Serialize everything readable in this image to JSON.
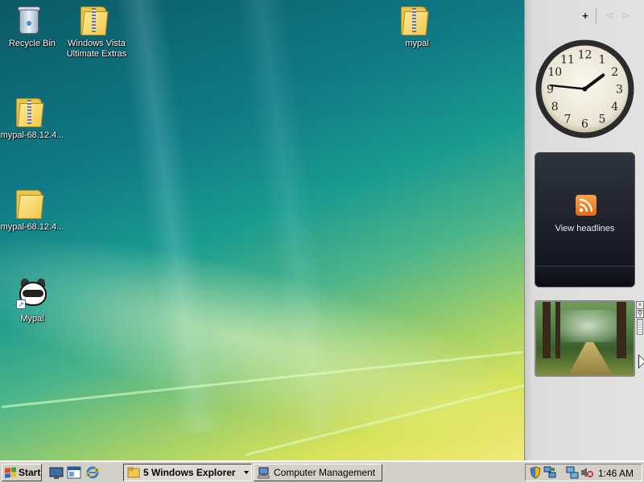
{
  "desktop": {
    "icons": [
      {
        "label": "Recycle Bin",
        "icon": "recycle-bin-icon"
      },
      {
        "label": "Windows Vista Ultimate Extras",
        "icon": "zip-folder-icon"
      },
      {
        "label": "mypal",
        "icon": "zip-folder-icon"
      },
      {
        "label": "mypal-68.12.4...",
        "icon": "zip-folder-icon"
      },
      {
        "label": "mypal-68.12.4...",
        "icon": "folder-icon"
      },
      {
        "label": "Mypal",
        "icon": "mypal-shortcut-icon"
      }
    ]
  },
  "sidebar": {
    "add_label": "+",
    "prev_label": "◁",
    "next_label": "▷",
    "clock": {
      "hour_numbers": [
        "12",
        "1",
        "2",
        "3",
        "4",
        "5",
        "6",
        "7",
        "8",
        "9",
        "10",
        "11"
      ],
      "hours": 1,
      "minutes": 46
    },
    "feed": {
      "text": "View headlines",
      "icon": "rss-icon"
    },
    "slideshow": {
      "icon": "forest-photo"
    }
  },
  "taskbar": {
    "start_label": "Start",
    "quick_launch": [
      "show-desktop-icon",
      "explorer-window-icon",
      "internet-explorer-icon"
    ],
    "buttons": [
      {
        "label": "5 Windows Explorer",
        "icon": "folder-icon",
        "active": true
      },
      {
        "label": "Computer Management",
        "icon": "computer-management-icon",
        "active": false
      }
    ],
    "tray": {
      "icons": [
        "security-shield-icon",
        "network-icon",
        "network-connection-icon",
        "volume-muted-icon"
      ],
      "time": "1:46 AM"
    }
  },
  "colors": {
    "accent_rss": "#f07a1e",
    "taskbar": "#d4d0c8"
  }
}
